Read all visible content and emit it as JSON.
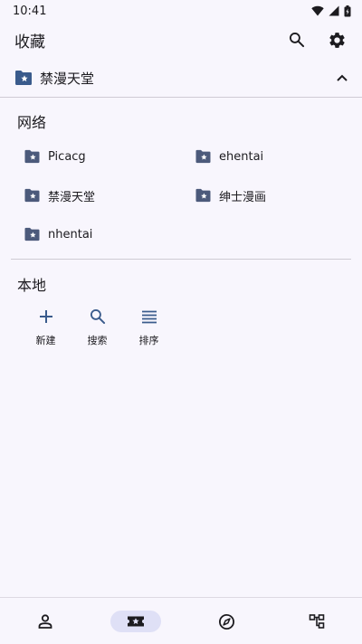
{
  "status_bar": {
    "time": "10:41"
  },
  "app_bar": {
    "title": "收藏"
  },
  "folder_header": {
    "title": "禁漫天堂"
  },
  "network": {
    "title": "网络",
    "folders": [
      {
        "label": "Picacg"
      },
      {
        "label": "ehentai"
      },
      {
        "label": "禁漫天堂"
      },
      {
        "label": "绅士漫画"
      },
      {
        "label": "nhentai"
      }
    ]
  },
  "local": {
    "title": "本地",
    "actions": [
      {
        "label": "新建",
        "icon": "plus-icon"
      },
      {
        "label": "搜索",
        "icon": "search-icon"
      },
      {
        "label": "排序",
        "icon": "sort-lines-icon"
      }
    ]
  },
  "bottom_nav": {
    "items": [
      {
        "icon": "person-icon",
        "active": false
      },
      {
        "icon": "favorite-folder-icon",
        "active": true
      },
      {
        "icon": "compass-icon",
        "active": false
      },
      {
        "icon": "category-tree-icon",
        "active": false
      }
    ]
  },
  "colors": {
    "background": "#f8f6fd",
    "folder_icon": "#4c5a7b",
    "accent_blue": "#3a5b8c",
    "nav_active_pill": "#dfe0f6"
  }
}
